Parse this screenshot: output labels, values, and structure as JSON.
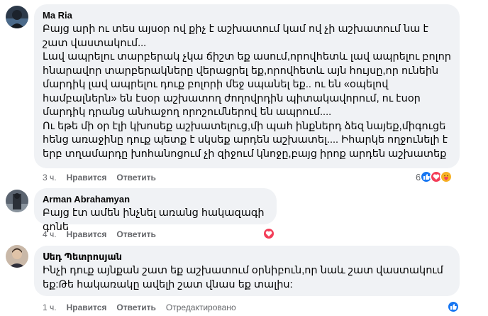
{
  "comments": [
    {
      "author": "Ma Ria",
      "text": "Բայց արի ու տես այսօր ով քիչ է աշխատում կամ ով չի աշխատում նա է շատ վաստակում...\nԼավ ապրելու տարբերակ չկա ճիշտ եք ասում,որովհետև լավ ապրելու բոլոր հնարավոր տարբերակները վերացրել եք,որովհետև այն հույսը,որ ունեին մարդիկ լավ ապրելու դուք բոլորի մեջ սպանել եք.. ու են «օպելով համբալներն» են էսօր աշխատող ժողովրդին պիտակավորում, ու էսօր մարդիկ դրանց անհաջող որոշումներով են ապրում....\nՈւ եթե մի օր էլի կխոսեք աշխատելուց,մի պահ ինքներդ ձեզ նայեք,միգուցե հենց առաջինը դուք պետք է սկսեք արդեն աշխատել.... Իհարկե ողջունելի է երբ տղամարդը խոհանոցում չի զիջում կնոջը,բայց իրոք արդեն աշխատեք",
      "time": "3 ч.",
      "like": "Нравится",
      "reply": "Ответить",
      "reaction_count": "6",
      "reactions": [
        "like-icon",
        "love-icon",
        "care-icon"
      ]
    },
    {
      "author": "Arman Abrahamyan",
      "text": "Բայց էտ ամեն ինչնել առանց հակազագի գոնե",
      "time": "4 ч.",
      "like": "Нравится",
      "reply": "Ответить",
      "reactions": [
        "love-icon"
      ]
    },
    {
      "author": "Սեդ Պետրոսյան",
      "text": "Ինչի դուք այնքան շատ եք աշխատում օրնիբուն,որ նաև շատ վաստակում եք:Թե հակառակը ավելի շատ վնաս եք տալիս:",
      "time": "1 ч.",
      "like": "Нравится",
      "reply": "Ответить",
      "edited": "Отредактировано",
      "reactions": [
        "like-icon"
      ]
    }
  ],
  "colors": {
    "bubble": "#f0f2f5",
    "like_blue": "#1877f2",
    "love_red": "#f33e58",
    "care_yellow": "#f7b125",
    "meta_gray": "#65676b"
  }
}
